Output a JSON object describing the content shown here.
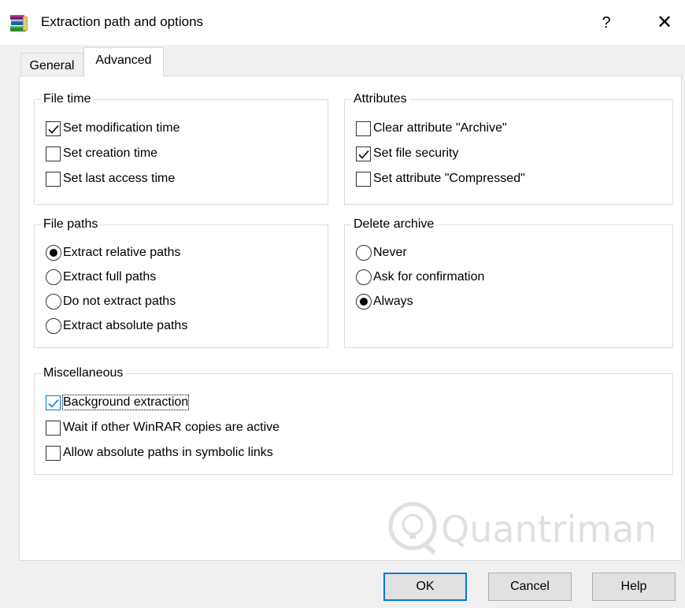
{
  "window": {
    "title": "Extraction path and options",
    "help_label": "?",
    "close_label": "✕",
    "app_icon": "winrar-books-icon"
  },
  "tabs": [
    {
      "label": "General",
      "active": false
    },
    {
      "label": "Advanced",
      "active": true
    }
  ],
  "file_time": {
    "legend": "File time",
    "options": [
      {
        "label": "Set modification time",
        "checked": true
      },
      {
        "label": "Set creation time",
        "checked": false
      },
      {
        "label": "Set last access time",
        "checked": false
      }
    ]
  },
  "attributes": {
    "legend": "Attributes",
    "options": [
      {
        "label": "Clear attribute \"Archive\"",
        "checked": false
      },
      {
        "label": "Set file security",
        "checked": true
      },
      {
        "label": "Set attribute \"Compressed\"",
        "checked": false
      }
    ]
  },
  "file_paths": {
    "legend": "File paths",
    "options": [
      {
        "label": "Extract relative paths",
        "selected": true
      },
      {
        "label": "Extract full paths",
        "selected": false
      },
      {
        "label": "Do not extract paths",
        "selected": false
      },
      {
        "label": "Extract absolute paths",
        "selected": false
      }
    ]
  },
  "delete_archive": {
    "legend": "Delete archive",
    "options": [
      {
        "label": "Never",
        "selected": false
      },
      {
        "label": "Ask for confirmation",
        "selected": false
      },
      {
        "label": "Always",
        "selected": true
      }
    ]
  },
  "miscellaneous": {
    "legend": "Miscellaneous",
    "options": [
      {
        "label": "Background extraction",
        "checked": true
      },
      {
        "label": "Wait if other WinRAR copies are active",
        "checked": false
      },
      {
        "label": "Allow absolute paths in symbolic links",
        "checked": false
      }
    ]
  },
  "buttons": {
    "ok": "OK",
    "cancel": "Cancel",
    "help": "Help"
  },
  "watermark": "Quantrimang",
  "colors": {
    "focus_accent": "#0078d7",
    "panel_bg": "#ffffff",
    "dialog_bg": "#f0f0f0"
  }
}
